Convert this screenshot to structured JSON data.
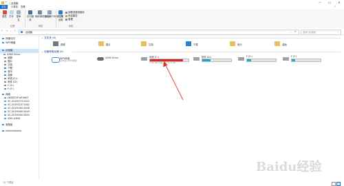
{
  "window": {
    "title": "| 此电脑",
    "controls": [
      "—",
      "☐",
      "✕"
    ]
  },
  "ribbon": {
    "tabs": [
      "文件",
      "计算机",
      "查看"
    ],
    "groups": [
      {
        "label": "位置",
        "buttons": [
          "属性",
          "打开",
          "重命名"
        ]
      },
      {
        "label": "网络",
        "buttons": [
          "访问媒体",
          "映射网络驱动器",
          "添加一个网络位置"
        ]
      },
      {
        "label": "系统",
        "buttons": [
          "打开设置",
          "卸载或更改程序",
          "系统属性",
          "管理"
        ]
      }
    ]
  },
  "address": {
    "path": "此电脑",
    "search_placeholder": "搜索\"此电脑\""
  },
  "sidebar": {
    "items": [
      {
        "label": "快速访问",
        "icon": "star-icon",
        "color": "#3b8ee8"
      },
      {
        "label": "WPS网盘",
        "icon": "cloud-icon",
        "color": "#3b8ee8"
      },
      {
        "label": "此电脑",
        "icon": "computer-icon",
        "color": "#3b8ee8",
        "selected": true
      },
      {
        "label": "A360 Drive",
        "icon": "drive-icon",
        "color": "#5aa0d6"
      },
      {
        "label": "视频",
        "icon": "video-icon",
        "color": "#7d8b99"
      },
      {
        "label": "图片",
        "icon": "picture-icon",
        "color": "#7d8b99"
      },
      {
        "label": "文档",
        "icon": "document-icon",
        "color": "#7d8b99"
      },
      {
        "label": "下载",
        "icon": "download-icon",
        "color": "#2a7fd1"
      },
      {
        "label": "音乐",
        "icon": "music-icon",
        "color": "#7d8b99"
      },
      {
        "label": "桌面",
        "icon": "desktop-icon",
        "color": "#3b8ee8"
      },
      {
        "label": "系统 (C:)",
        "icon": "drive-icon",
        "color": "#7d8b99"
      },
      {
        "label": "软件 (D:)",
        "icon": "drive-icon",
        "color": "#7d8b99"
      },
      {
        "label": "F (E:)",
        "icon": "drive-icon",
        "color": "#7d8b99"
      },
      {
        "label": "F (F:)",
        "icon": "drive-icon",
        "color": "#7d8b99"
      },
      {
        "label": "网络",
        "icon": "network-icon",
        "color": "#3b8ee8"
      },
      {
        "label": "DESKTOP-NF3HKT",
        "icon": "pc-icon",
        "color": "#5aa0d6"
      },
      {
        "label": "SC-201907121322",
        "icon": "pc-icon",
        "color": "#5aa0d6"
      },
      {
        "label": "SC-201911071042",
        "icon": "pc-icon",
        "color": "#5aa0d6"
      },
      {
        "label": "SC-201904011448",
        "icon": "pc-icon",
        "color": "#5aa0d6"
      },
      {
        "label": "SC-201904011449",
        "icon": "pc-icon",
        "color": "#5aa0d6"
      },
      {
        "label": "SC-201904011610",
        "icon": "pc-icon",
        "color": "#5aa0d6"
      },
      {
        "label": "ZHU-LONG",
        "icon": "pc-icon",
        "color": "#5aa0d6"
      },
      {
        "label": "家庭组",
        "icon": "homegroup-icon",
        "color": "#3b8ee8"
      },
      {
        "label": "Administrator",
        "icon": "user-icon",
        "color": "#3b8ee8"
      }
    ]
  },
  "folders": {
    "header": "文件夹 (6)",
    "items": [
      {
        "label": "视频",
        "color": "#6c7b8a"
      },
      {
        "label": "图片",
        "color": "#e8c05a"
      },
      {
        "label": "文档",
        "color": "#e8c05a"
      },
      {
        "label": "下载",
        "color": "#2a7fd1"
      },
      {
        "label": "音乐",
        "color": "#e8c05a"
      },
      {
        "label": "桌面",
        "color": "#e8c05a"
      }
    ]
  },
  "devices": {
    "header": "设备和驱动器 (6)",
    "items": [
      {
        "name": "WPS网盘",
        "sub": "双击进入WPS网盘",
        "type": "cloud"
      },
      {
        "name": "A360 Drive",
        "sub": "",
        "type": "a360"
      },
      {
        "name": "系统 (C:)",
        "sub": "7.00 GB 可用，共 50.0 GB",
        "used_fraction": 0.86,
        "bar_color": "#da2626"
      },
      {
        "name": "软件 (D:)",
        "sub": "",
        "used_fraction": 0.28,
        "bar_color": "#26a0da"
      },
      {
        "name": "F (E:)",
        "sub": "",
        "used_fraction": 0.15,
        "bar_color": "#26a0da"
      },
      {
        "name": "F (F:)",
        "sub": "",
        "used_fraction": 0.12,
        "bar_color": "#26a0da"
      }
    ]
  },
  "status": {
    "count": "12 个项目"
  },
  "watermark": "Baidu经验",
  "colors": {
    "accent": "#1a6dc9",
    "annotation": "#e0302a"
  }
}
